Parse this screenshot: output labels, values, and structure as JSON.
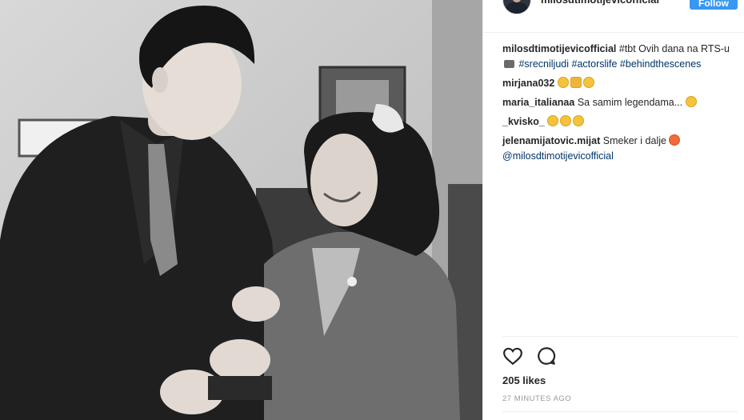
{
  "post": {
    "username": "milosdtimotijevicofficial",
    "follow_label": "Follow",
    "caption": {
      "user": "milosdtimotijevicofficial",
      "text_1": " #tbt Ovih dana na RTS-u ",
      "tags": "#srecniljudi #actorslife #behindthescenes"
    },
    "comments": [
      {
        "user": "mirjana032",
        "text": ""
      },
      {
        "user": "maria_italianaa",
        "text": " Sa samim legendama... "
      },
      {
        "user": "_kvisko_",
        "text": ""
      },
      {
        "user": "jelenamijatovic.mijat",
        "text": " Smeker i dalje ",
        "mention": "@milosdtimotijevicofficial"
      }
    ],
    "likes": "205 likes",
    "time": "27 MINUTES AGO"
  },
  "icons": {
    "like": "heart-icon",
    "comment": "comment-bubble-icon"
  },
  "colors": {
    "follow_button": "#3897f0",
    "hashtag": "#003569",
    "text": "#262626",
    "muted": "#999999"
  }
}
